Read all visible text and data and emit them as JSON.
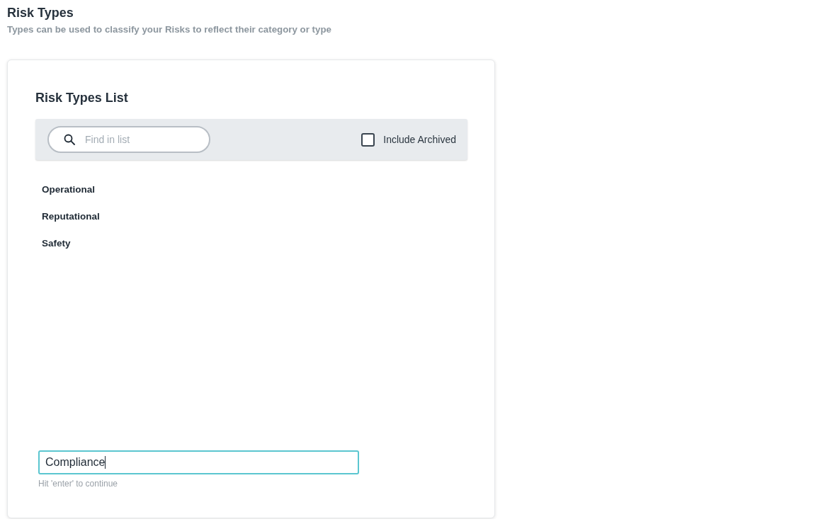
{
  "page": {
    "title": "Risk Types",
    "subtitle": "Types can be used to classify your Risks to reflect their category or type"
  },
  "card": {
    "title": "Risk Types List",
    "search": {
      "placeholder": "Find in list"
    },
    "include_archived": {
      "label": "Include Archived",
      "checked": false
    },
    "items": [
      "Operational",
      "Reputational",
      "Safety"
    ],
    "new_item": {
      "value": "Compliance",
      "focused": true,
      "hint": "Hit 'enter' to continue"
    }
  }
}
